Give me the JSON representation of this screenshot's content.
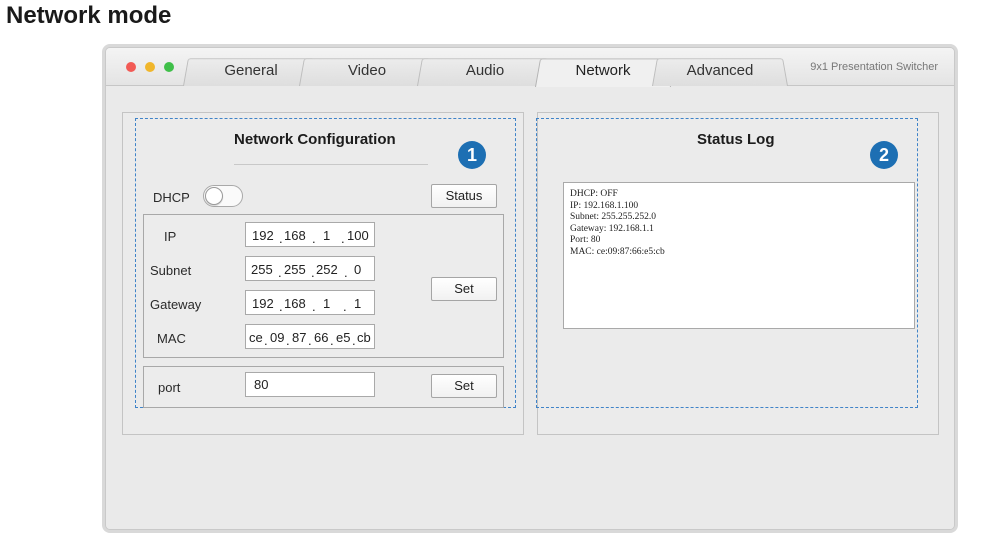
{
  "doc": {
    "title": "Network mode"
  },
  "window": {
    "app_name": "9x1 Presentation Switcher",
    "tabs": [
      {
        "label": "General"
      },
      {
        "label": "Video"
      },
      {
        "label": "Audio"
      },
      {
        "label": "Network",
        "active": true
      },
      {
        "label": "Advanced"
      }
    ]
  },
  "network_config": {
    "title": "Network Configuration",
    "badge": "1",
    "dhcp_label": "DHCP",
    "dhcp_on": false,
    "status_button": "Status",
    "set_button": "Set",
    "port_set_button": "Set",
    "ip": {
      "label": "IP",
      "segments": [
        "192",
        "168",
        "1",
        "100"
      ]
    },
    "subnet": {
      "label": "Subnet",
      "segments": [
        "255",
        "255",
        "252",
        "0"
      ]
    },
    "gateway": {
      "label": "Gateway",
      "segments": [
        "192",
        "168",
        "1",
        "1"
      ]
    },
    "mac": {
      "label": "MAC",
      "segments": [
        "ce",
        "09",
        "87",
        "66",
        "e5",
        "cb"
      ]
    },
    "port": {
      "label": "port",
      "value": "80"
    }
  },
  "status_log": {
    "title": "Status Log",
    "badge": "2",
    "lines": [
      "DHCP: OFF",
      "IP: 192.168.1.100",
      "Subnet: 255.255.252.0",
      "Gateway: 192.168.1.1",
      "Port: 80",
      "MAC: ce:09:87:66:e5:cb"
    ]
  },
  "colors": {
    "badge": "#1d6fb3",
    "dashed_border": "#3f83c8"
  }
}
